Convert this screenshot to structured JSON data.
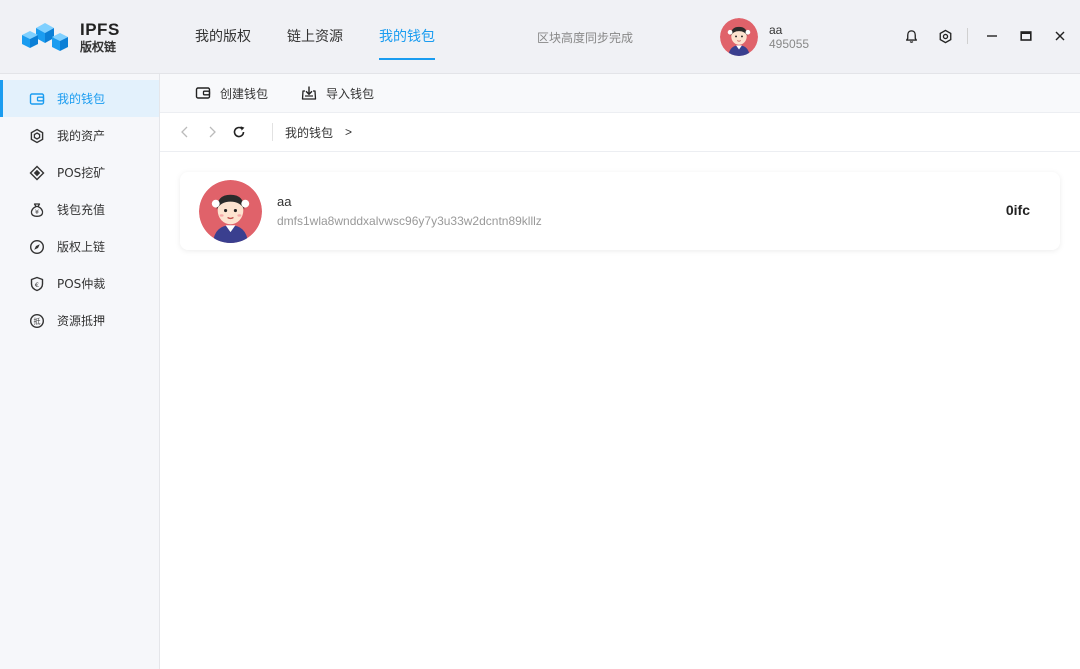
{
  "app": {
    "logo_title": "IPFS",
    "logo_subtitle": "版权链",
    "colors": {
      "accent": "#1a9cf0",
      "header_bg": "#f0f1f5",
      "sidebar_bg": "#f6f7fa",
      "avatar_bg": "#e0626a"
    }
  },
  "nav": {
    "items": [
      {
        "label": "我的版权"
      },
      {
        "label": "链上资源"
      },
      {
        "label": "我的钱包"
      }
    ],
    "active_index": 2
  },
  "sync_status": "区块高度同步完成",
  "user": {
    "name": "aa",
    "id": "495055"
  },
  "header_icons": [
    "bell-icon",
    "gear-icon",
    "minimize-icon",
    "maximize-icon",
    "close-icon"
  ],
  "sidebar": {
    "items": [
      {
        "label": "我的钱包",
        "icon": "wallet-icon"
      },
      {
        "label": "我的资产",
        "icon": "hexagon-icon"
      },
      {
        "label": "POS挖矿",
        "icon": "diamond-icon"
      },
      {
        "label": "钱包充值",
        "icon": "money-bag-icon"
      },
      {
        "label": "版权上链",
        "icon": "compass-icon"
      },
      {
        "label": "POS仲裁",
        "icon": "shield-icon"
      },
      {
        "label": "资源抵押",
        "icon": "mortgage-icon"
      }
    ],
    "active_index": 0
  },
  "toolbar": {
    "create_label": "创建钱包",
    "import_label": "导入钱包"
  },
  "breadcrumb": {
    "current": "我的钱包",
    "arrow": ">"
  },
  "wallet": {
    "name": "aa",
    "address": "dmfs1wla8wnddxalvwsc96y7y3u33w2dcntn89klllz",
    "balance": "0ifc"
  }
}
